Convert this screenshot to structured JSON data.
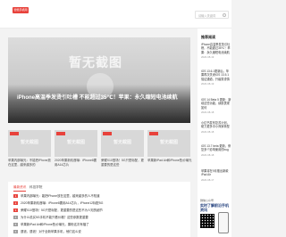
{
  "header": {
    "logo": "智能手机网",
    "search_placeholder": "请输入关键词"
  },
  "hero": {
    "placeholder": "暂无截图",
    "title": "iPhone高温季发烫引吐槽 不能超过35℃！苹果：永久缩短电池续航"
  },
  "thumbs": [
    {
      "placeholder": "暂无截图",
      "caption": "苹果内部曝光：不能把iPhone放在这里，越来越多的"
    },
    {
      "placeholder": "暂无截图",
      "caption": "2020苹果新机首曝：iPhone8要用A14芯片"
    },
    {
      "placeholder": "暂无截图",
      "caption": "荣耀X10登场！5G只是标配，更重要的是这些"
    },
    {
      "placeholder": "暂无截图",
      "caption": "苹果新iPad Air和iPhone售价曝光"
    }
  ],
  "news": {
    "tabs": [
      "最新资讯",
      "科技学院"
    ],
    "items": [
      {
        "num": "1",
        "text": "苹果内部曝光：能把iPhone放在这里，越来越多的人不知道"
      },
      {
        "num": "2",
        "text": "2020苹果新机首曝：iPhone8要用A14芯片，iPhone12标配5G"
      },
      {
        "num": "3",
        "text": "荣耀X10登场！5G只是标配，更重要的是这些不为人知的细节"
      },
      {
        "num": "4",
        "text": "为什么说买5G手机不能只看价格？这些参数更重要"
      },
      {
        "num": "5",
        "text": "苹果新iPad Air和iPhone售价曝光，果粉这次有福了"
      },
      {
        "num": "6",
        "text": "退钱，退钱！对于全新苹果手机，他们这么说"
      }
    ]
  },
  "sidebar": {
    "title": "推荐阅读",
    "items": [
      {
        "text": "iPhone高温季发烫引吐槽，不能超过35℃！苹果：永久缩短电池续航",
        "date": "2020-08-19"
      },
      {
        "text": "iOS 13.6.1更新后，苹果再次关闭iOS 13.5.1验证通道，升级需谨慎",
        "date": "2020-08-19"
      },
      {
        "text": "iOS 14 Beta 5 更新：新增这些功能，续航表现如何",
        "date": "2020-08-18"
      },
      {
        "text": "小红书发布复苏计划，助力更多中小商家转型",
        "date": "2020-08-18"
      },
      {
        "text": "iOS 13.7 beta 更新，修复多个影响使用的bug",
        "date": "2020-08-18"
      },
      {
        "text": "苹果将在9月推出新款iPad Air",
        "date": "2020-08-17"
      }
    ]
  },
  "promo": {
    "head": "微信公众号",
    "title": "实时了解前沿手机资讯"
  }
}
